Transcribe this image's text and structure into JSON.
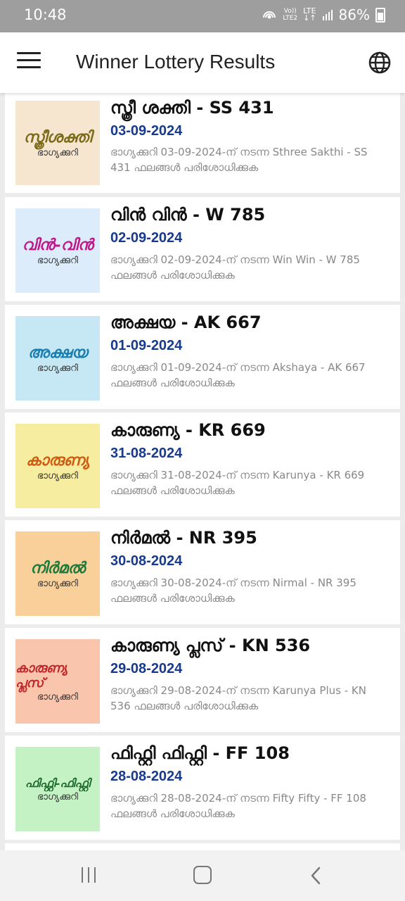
{
  "status_bar": {
    "time": "10:48",
    "volte": "Vo))",
    "lte2": "LTE2",
    "lte": "LTE",
    "battery": "86%"
  },
  "app_bar": {
    "title": "Winner Lottery Results",
    "menu_icon": "hamburger-menu-icon",
    "language_icon": "globe-icon"
  },
  "results": [
    {
      "name": "സ്ത്രീ ശക്തി - SS 431",
      "date": "03-09-2024",
      "desc": "ഭാഗ്യക്കുറി 03-09-2024-ന് നടന്ന Sthree Sakthi - SS 431 ഫലങ്ങൾ പരിശോധിക്കുക",
      "logo": "സ്ത്രീശക്തി",
      "logo_sub": "ഭാഗ്യക്കുറി",
      "bg": "#f6e6cf",
      "fg": "#7a6a1a"
    },
    {
      "name": "വിൻ വിൻ - W 785",
      "date": "02-09-2024",
      "desc": "ഭാഗ്യക്കുറി 02-09-2024-ന് നടന്ന Win Win - W 785 ഫലങ്ങൾ പരിശോധിക്കുക",
      "logo": "വിൻ-വിൻ",
      "logo_sub": "ഭാഗ്യക്കുറി",
      "bg": "#dcecfa",
      "fg": "#c0168a"
    },
    {
      "name": "അക്ഷയ - AK 667",
      "date": "01-09-2024",
      "desc": "ഭാഗ്യക്കുറി 01-09-2024-ന് നടന്ന Akshaya - AK 667 ഫലങ്ങൾ പരിശോധിക്കുക",
      "logo": "അക്ഷയ",
      "logo_sub": "ഭാഗ്യക്കുറി",
      "bg": "#c6e8f5",
      "fg": "#1a7fb0"
    },
    {
      "name": "കാരുണ്യ - KR 669",
      "date": "31-08-2024",
      "desc": "ഭാഗ്യക്കുറി 31-08-2024-ന് നടന്ന Karunya - KR 669 ഫലങ്ങൾ പരിശോധിക്കുക",
      "logo": "കാരുണ്യ",
      "logo_sub": "ഭാഗ്യക്കുറി",
      "bg": "#f7eda0",
      "fg": "#d05a10"
    },
    {
      "name": "നിർമൽ - NR 395",
      "date": "30-08-2024",
      "desc": "ഭാഗ്യക്കുറി 30-08-2024-ന് നടന്ന Nirmal - NR 395 ഫലങ്ങൾ പരിശോധിക്കുക",
      "logo": "നിർമൽ",
      "logo_sub": "ഭാഗ്യക്കുറി",
      "bg": "#f9cf9a",
      "fg": "#1d7a3a"
    },
    {
      "name": "കാരുണ്യ പ്ലസ് - KN 536",
      "date": "29-08-2024",
      "desc": "ഭാഗ്യക്കുറി 29-08-2024-ന് നടന്ന Karunya Plus - KN 536 ഫലങ്ങൾ പരിശോധിക്കുക",
      "logo": "കാരുണ്യ പ്ലസ്",
      "logo_sub": "ഭാഗ്യക്കുറി",
      "bg": "#f9c6ad",
      "fg": "#c0252a"
    },
    {
      "name": "ഫിഫ്റ്റി ഫിഫ്റ്റി - FF 108",
      "date": "28-08-2024",
      "desc": "ഭാഗ്യക്കുറി 28-08-2024-ന് നടന്ന Fifty Fifty - FF 108 ഫലങ്ങൾ പരിശോധിക്കുക",
      "logo": "ഫിഫ്റ്റി-ഫിഫ്റ്റി",
      "logo_sub": "ഭാഗ്യക്കുറി",
      "bg": "#c4f2c4",
      "fg": "#1d6a2a"
    }
  ],
  "nav_bar": {
    "recent_icon": "recent-apps-icon",
    "home_icon": "home-icon",
    "back_icon": "back-icon"
  }
}
